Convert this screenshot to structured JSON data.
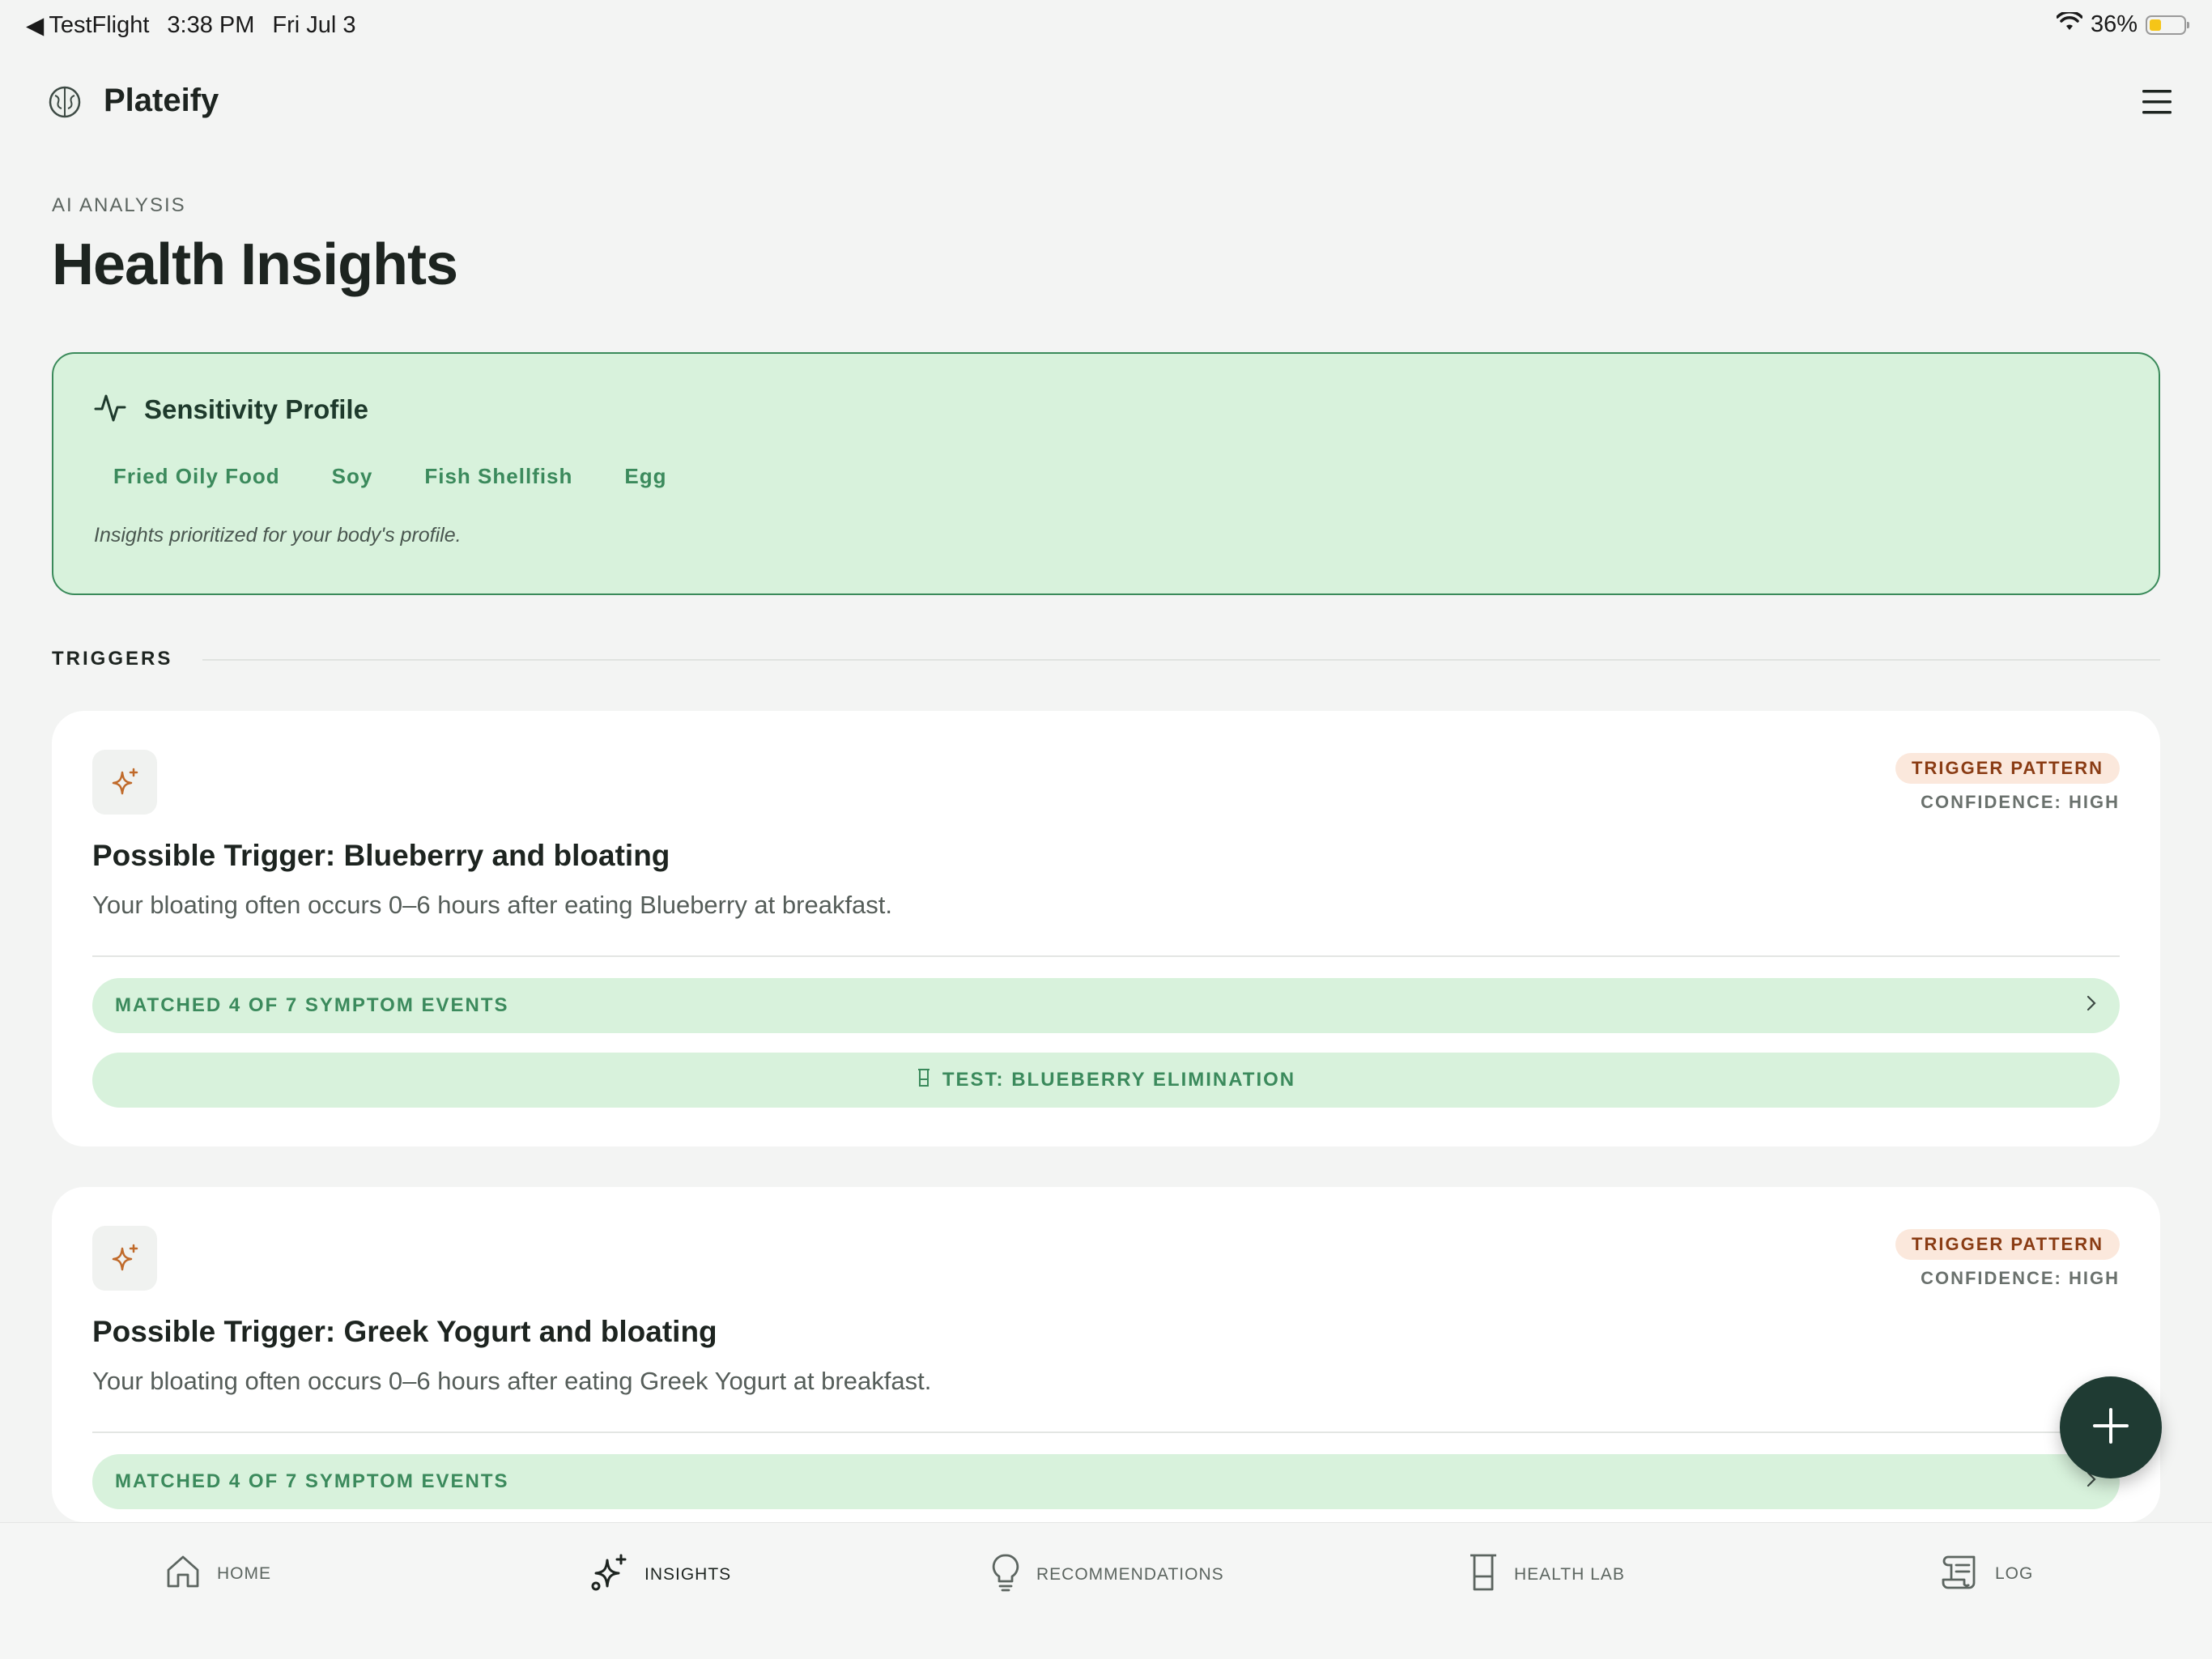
{
  "status_bar": {
    "back_app": "TestFlight",
    "time": "3:38 PM",
    "date": "Fri Jul 3",
    "battery": "36%",
    "battery_level": 0.36
  },
  "header": {
    "app_name": "Plateify",
    "logo_icon": "brain-icon",
    "menu_icon": "hamburger-menu-icon"
  },
  "page": {
    "eyebrow": "AI ANALYSIS",
    "title": "Health Insights"
  },
  "sensitivity_profile": {
    "title": "Sensitivity Profile",
    "icon": "pulse-icon",
    "chips": [
      "Fried Oily Food",
      "Soy",
      "Fish Shellfish",
      "Egg"
    ],
    "note": "Insights prioritized for your body's profile."
  },
  "triggers_section": {
    "label": "TRIGGERS"
  },
  "insights": [
    {
      "icon": "sparkles-icon",
      "badge": "TRIGGER PATTERN",
      "confidence": "CONFIDENCE: HIGH",
      "title": "Possible Trigger: Blueberry and bloating",
      "description": "Your bloating often occurs 0–6 hours after eating Blueberry at breakfast.",
      "matched_label": "MATCHED 4 OF 7 SYMPTOM EVENTS",
      "test_label": "TEST: BLUEBERRY ELIMINATION"
    },
    {
      "icon": "sparkles-icon",
      "badge": "TRIGGER PATTERN",
      "confidence": "CONFIDENCE: HIGH",
      "title": "Possible Trigger: Greek Yogurt and bloating",
      "description": "Your bloating often occurs 0–6 hours after eating Greek Yogurt at breakfast.",
      "matched_label": "MATCHED 4 OF 7 SYMPTOM EVENTS"
    }
  ],
  "fab": {
    "icon": "plus-icon"
  },
  "bottom_nav": [
    {
      "label": "HOME",
      "icon": "home-icon"
    },
    {
      "label": "INSIGHTS",
      "icon": "sparkles-icon",
      "active": true
    },
    {
      "label": "RECOMMENDATIONS",
      "icon": "lightbulb-icon"
    },
    {
      "label": "HEALTH LAB",
      "icon": "beaker-icon"
    },
    {
      "label": "LOG",
      "icon": "scroll-icon"
    }
  ],
  "colors": {
    "brand_dark": "#1f3b33",
    "accent_green": "#3b8a5c",
    "accent_green_bg": "#d8f2dc",
    "badge_bg": "#fbe8dc",
    "badge_text": "#8a3c14",
    "sparkle_orange": "#c06a2a"
  }
}
